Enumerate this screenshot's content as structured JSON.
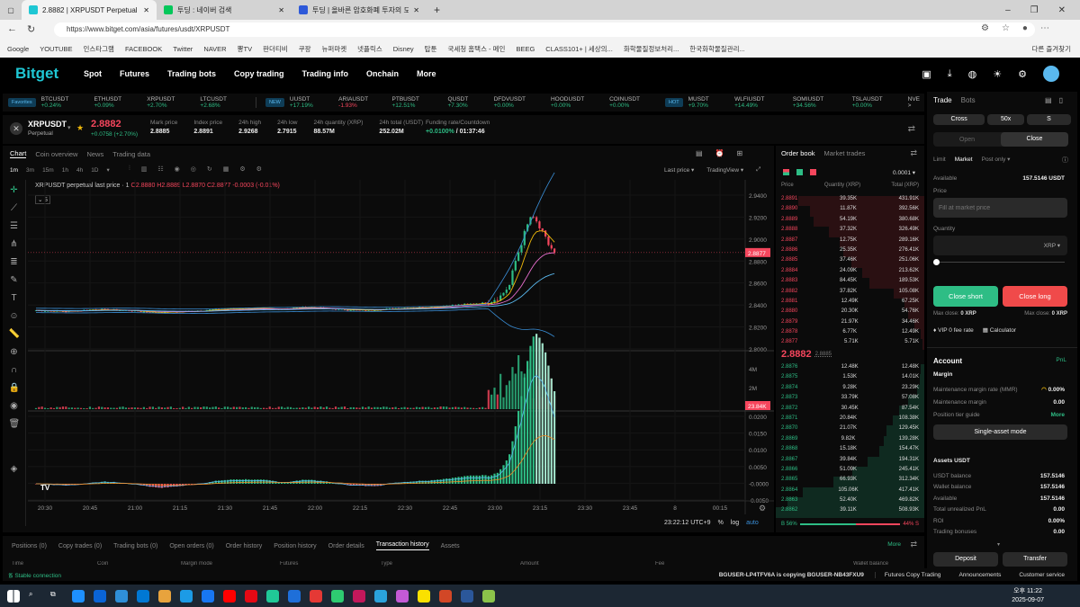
{
  "browser": {
    "tabs": [
      {
        "title": "2.8882 | XRPUSDT Perpetual | USD",
        "color": "#1fc7d4"
      },
      {
        "title": "투딩 : 네이버 검색",
        "color": "#03c75a"
      },
      {
        "title": "투딩 | 올바른 암호화폐 투자의 도",
        "color": "#2e59d9"
      }
    ],
    "url": "https://www.bitget.com/asia/futures/usdt/XRPUSDT",
    "bookmarks": [
      "Google",
      "YOUTUBE",
      "인스타그램",
      "FACEBOOK",
      "Twitter",
      "NAVER",
      "뽕TV",
      "판더티비",
      "쿠팡",
      "뉴퍼마켓",
      "넷플릭스",
      "Disney",
      "탑툰",
      "국세청 홈택스 - 메인",
      "BEEG",
      "CLASS101+ | 세상의...",
      "화학물질정보처리...",
      "한국화학물질관리..."
    ],
    "other_favorites": "다른 즐겨찾기"
  },
  "nav": {
    "logo": "Bitget",
    "items": [
      "Spot",
      "Futures",
      "Trading bots",
      "Copy trading",
      "Trading info",
      "Onchain",
      "More"
    ]
  },
  "ticker": {
    "favorites_label": "Favorites",
    "favorites": [
      {
        "s": "BTCUSDT",
        "c": "+0.24%",
        "up": true
      },
      {
        "s": "ETHUSDT",
        "c": "+0.09%",
        "up": true
      },
      {
        "s": "XRPUSDT",
        "c": "+2.70%",
        "up": true
      },
      {
        "s": "LTCUSDT",
        "c": "+2.68%",
        "up": true
      }
    ],
    "new_label": "NEW",
    "new": [
      {
        "s": "UUSDT",
        "c": "+17.19%",
        "up": true
      },
      {
        "s": "ARIAUSDT",
        "c": "-1.93%",
        "up": false
      },
      {
        "s": "PTBUSDT",
        "c": "+12.51%",
        "up": true
      },
      {
        "s": "QUSDT",
        "c": "+7.30%",
        "up": true
      },
      {
        "s": "DFDVUSDT",
        "c": "+0.00%",
        "up": true
      },
      {
        "s": "HOODUSDT",
        "c": "+0.00%",
        "up": true
      },
      {
        "s": "COINUSDT",
        "c": "+0.00%",
        "up": true
      }
    ],
    "hot_label": "HOT",
    "hot": [
      {
        "s": "MUSDT",
        "c": "+9.70%",
        "up": true
      },
      {
        "s": "WLFIUSDT",
        "c": "+14.49%",
        "up": true
      },
      {
        "s": "SOMIUSDT",
        "c": "+34.56%",
        "up": true
      },
      {
        "s": "TSLAUSDT",
        "c": "+0.00%",
        "up": true
      }
    ],
    "more": "NVE >"
  },
  "symbol": {
    "name": "XRPUSDT",
    "type": "Perpetual",
    "price": "2.8882",
    "change": "+0.0758 (+2.70%)",
    "stats": [
      {
        "l": "Mark price",
        "v": "2.8885"
      },
      {
        "l": "Index price",
        "v": "2.8891"
      },
      {
        "l": "24h high",
        "v": "2.9268"
      },
      {
        "l": "24h low",
        "v": "2.7915"
      },
      {
        "l": "24h quantity (XRP)",
        "v": "88.57M"
      },
      {
        "l": "24h total (USDT)",
        "v": "252.02M"
      }
    ],
    "funding_label": "Funding rate/Countdown",
    "funding_rate": "+0.0100%",
    "countdown": "/ 01:37:46"
  },
  "chart": {
    "tabs": [
      "Chart",
      "Coin overview",
      "News",
      "Trading data"
    ],
    "intervals": [
      "1m",
      "3m",
      "15m",
      "1h",
      "4h",
      "1D"
    ],
    "last_price_select": "Last price ▾",
    "tv_select": "TradingView ▾",
    "legend": "XRPUSDT perpetual last price · 1",
    "ohlc": "O2.8880 H2.8889 L2.8870 C2.8877 -0.0003 (-0.01%)",
    "indicator_count": "5",
    "price_ticks": [
      "2.9400",
      "2.9200",
      "2.9000",
      "2.8800",
      "2.8600",
      "2.8400",
      "2.8200",
      "2.8000"
    ],
    "current_price_tag": "2.8877",
    "volume_ticks": [
      "4M",
      "2M"
    ],
    "volume_tag": "23.84K",
    "macd_ticks": [
      "0.0200",
      "0.0150",
      "0.0100",
      "0.0050",
      "-0.0000",
      "-0.0050"
    ],
    "time_ticks": [
      "20:30",
      "20:45",
      "21:00",
      "21:15",
      "21:30",
      "21:45",
      "22:00",
      "22:15",
      "22:30",
      "22:45",
      "23:00",
      "23:15",
      "23:30",
      "23:45",
      "8",
      "00:15"
    ],
    "clock": "23:22:12 UTC+9",
    "pct": "%",
    "log": "log",
    "auto": "auto",
    "price_path": [
      [
        0,
        2.835
      ],
      [
        10,
        2.834
      ],
      [
        20,
        2.836
      ],
      [
        30,
        2.835
      ],
      [
        40,
        2.833
      ],
      [
        50,
        2.834
      ],
      [
        60,
        2.836
      ],
      [
        70,
        2.837
      ],
      [
        80,
        2.836
      ],
      [
        90,
        2.838
      ],
      [
        100,
        2.836
      ],
      [
        110,
        2.835
      ],
      [
        120,
        2.837
      ],
      [
        130,
        2.838
      ],
      [
        140,
        2.84
      ],
      [
        150,
        2.842
      ],
      [
        155,
        2.848
      ],
      [
        158,
        2.858
      ],
      [
        160,
        2.88
      ],
      [
        163,
        2.905
      ],
      [
        165,
        2.92
      ],
      [
        167,
        2.915
      ],
      [
        169,
        2.905
      ],
      [
        171,
        2.895
      ],
      [
        173,
        2.8877
      ]
    ],
    "colors": {
      "up": "#2ebd85",
      "down": "#f6465d"
    }
  },
  "orderbook": {
    "tabs": [
      "Order book",
      "Market trades"
    ],
    "precision": "0.0001 ▾",
    "headers": [
      "Price",
      "Quantity (XRP)",
      "Total (XRP)"
    ],
    "asks": [
      [
        "2.8891",
        "39.35K",
        "431.91K"
      ],
      [
        "2.8890",
        "11.87K",
        "392.56K"
      ],
      [
        "2.8889",
        "54.19K",
        "380.68K"
      ],
      [
        "2.8888",
        "37.32K",
        "326.49K"
      ],
      [
        "2.8887",
        "12.75K",
        "289.16K"
      ],
      [
        "2.8886",
        "25.35K",
        "276.41K"
      ],
      [
        "2.8885",
        "37.46K",
        "251.06K"
      ],
      [
        "2.8884",
        "24.09K",
        "213.62K"
      ],
      [
        "2.8883",
        "84.45K",
        "189.53K"
      ],
      [
        "2.8882",
        "37.82K",
        "105.08K"
      ],
      [
        "2.8881",
        "12.49K",
        "67.25K"
      ],
      [
        "2.8880",
        "20.30K",
        "54.76K"
      ],
      [
        "2.8879",
        "21.97K",
        "34.46K"
      ],
      [
        "2.8878",
        "6.77K",
        "12.49K"
      ],
      [
        "2.8877",
        "5.71K",
        "5.71K"
      ]
    ],
    "last": "2.8882",
    "mark": "2.8885",
    "bids": [
      [
        "2.8876",
        "12.48K",
        "12.48K"
      ],
      [
        "2.8875",
        "1.53K",
        "14.01K"
      ],
      [
        "2.8874",
        "9.28K",
        "23.29K"
      ],
      [
        "2.8873",
        "33.79K",
        "57.08K"
      ],
      [
        "2.8872",
        "30.45K",
        "87.54K"
      ],
      [
        "2.8871",
        "20.84K",
        "108.38K"
      ],
      [
        "2.8870",
        "21.07K",
        "129.45K"
      ],
      [
        "2.8869",
        "9.82K",
        "139.28K"
      ],
      [
        "2.8868",
        "15.18K",
        "154.47K"
      ],
      [
        "2.8867",
        "39.84K",
        "194.31K"
      ],
      [
        "2.8866",
        "51.09K",
        "245.41K"
      ],
      [
        "2.8865",
        "66.93K",
        "312.34K"
      ],
      [
        "2.8864",
        "105.06K",
        "417.41K"
      ],
      [
        "2.8863",
        "52.40K",
        "469.82K"
      ],
      [
        "2.8862",
        "39.11K",
        "508.93K"
      ]
    ],
    "buy_pct": "B 56%",
    "sell_pct": "44% S",
    "buy_ratio": 0.56
  },
  "trade": {
    "tabs": [
      "Trade",
      "Bots"
    ],
    "margin_mode": "Cross",
    "leverage": "50x",
    "s": "S",
    "open": "Open",
    "close": "Close",
    "order_types": [
      "Limit",
      "Market",
      "Post only ▾"
    ],
    "available_label": "Available",
    "available": "157.5146 USDT",
    "price_label": "Price",
    "price_placeholder": "Fill at market price",
    "quantity_label": "Quantity",
    "unit": "XRP ▾",
    "close_short": "Close short",
    "close_long": "Close long",
    "max_close_label": "Max close:",
    "max_close_short": "0 XRP",
    "max_close_long": "0 XRP",
    "vip": "VIP 0 fee rate",
    "calculator": "Calculator"
  },
  "account": {
    "title": "Account",
    "pnl": "PnL",
    "margin_title": "Margin",
    "mmr_label": "Maintenance margin rate (MMR)",
    "mmr": "0.00%",
    "mm_label": "Maintenance margin",
    "mm": "0.00",
    "tier_label": "Position tier guide",
    "tier_more": "More",
    "single_asset": "Single-asset mode",
    "assets_title": "Assets USDT",
    "rows": [
      {
        "l": "USDT balance",
        "v": "157.5146"
      },
      {
        "l": "Wallet balance",
        "v": "157.5146"
      },
      {
        "l": "Available",
        "v": "157.5146"
      },
      {
        "l": "Total unrealized PnL",
        "v": "0.00"
      },
      {
        "l": "ROI",
        "v": "0.00%"
      },
      {
        "l": "Trading bonuses",
        "v": "0.00"
      }
    ],
    "deposit": "Deposit",
    "transfer": "Transfer"
  },
  "bottom": {
    "tabs": [
      "Positions (0)",
      "Copy trades (0)",
      "Trading bots (0)",
      "Open orders (0)",
      "Order history",
      "Position history",
      "Order details",
      "Transaction history",
      "Assets"
    ],
    "active": 7,
    "more": "More",
    "columns": [
      "Time",
      "Coin",
      "Margin mode",
      "Futures",
      "Type",
      "Amount",
      "Fee",
      "Wallet balance"
    ]
  },
  "status": {
    "connection": "Stable connection",
    "copy_notice": "BGUSER-LP4TFV6A is copying BGUSER-NB43FXU9",
    "links": [
      "Futures Copy Trading",
      "Announcements",
      "Customer service"
    ]
  },
  "taskbar": {
    "time": "오후 11:22",
    "date": "2025-09-07"
  }
}
